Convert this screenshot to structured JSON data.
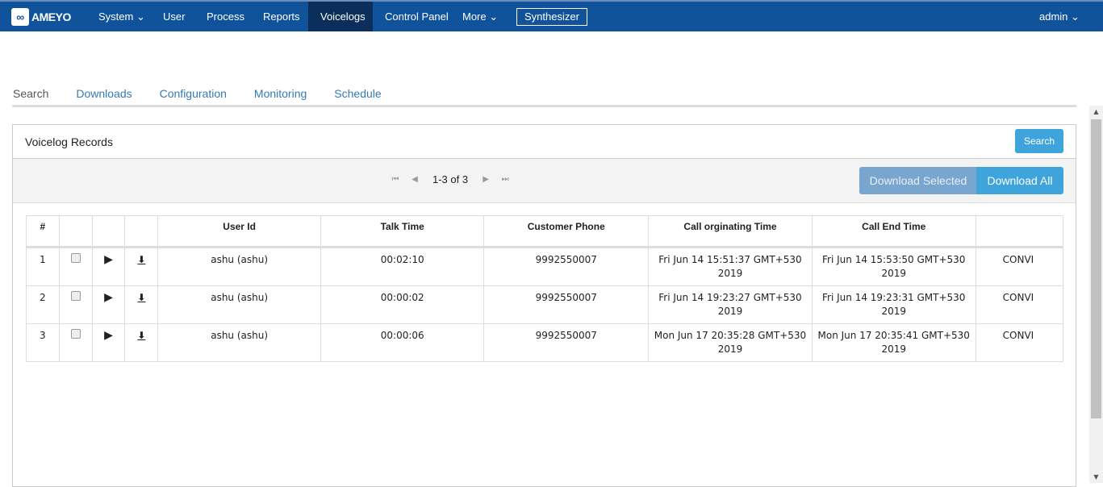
{
  "nav": {
    "logo": "AMEYO",
    "items": [
      "System",
      "User",
      "Process",
      "Reports",
      "Voicelogs",
      "Control Panel",
      "More"
    ],
    "active": "Voicelogs",
    "synthesizer": "Synthesizer",
    "user": "admin"
  },
  "tabs": [
    "Search",
    "Downloads",
    "Configuration",
    "Monitoring",
    "Schedule"
  ],
  "panel": {
    "title": "Voicelog Records",
    "search_button": "Search",
    "pager": "1-3 of 3",
    "download_selected": "Download Selected",
    "download_all": "Download All"
  },
  "table": {
    "headers": [
      "#",
      "",
      "",
      "",
      "User Id",
      "Talk Time",
      "Customer Phone",
      "Call orginating Time",
      "Call End Time",
      ""
    ],
    "rows": [
      {
        "n": "1",
        "user": "ashu (ashu)",
        "talk": "00:02:10",
        "phone": "9992550007",
        "start": "Fri Jun 14 15:51:37 GMT+530 2019",
        "end": "Fri Jun 14 15:53:50 GMT+530 2019",
        "status": "CONVI"
      },
      {
        "n": "2",
        "user": "ashu (ashu)",
        "talk": "00:00:02",
        "phone": "9992550007",
        "start": "Fri Jun 14 19:23:27 GMT+530 2019",
        "end": "Fri Jun 14 19:23:31 GMT+530 2019",
        "status": "CONVI"
      },
      {
        "n": "3",
        "user": "ashu (ashu)",
        "talk": "00:00:06",
        "phone": "9992550007",
        "start": "Mon Jun 17 20:35:28 GMT+530 2019",
        "end": "Mon Jun 17 20:35:41 GMT+530 2019",
        "status": "CONVI"
      }
    ]
  },
  "colors": {
    "nav": "#11539b",
    "active": "#0b2f5a",
    "button": "#3fa3dc",
    "button_disabled": "#79a6cf"
  }
}
